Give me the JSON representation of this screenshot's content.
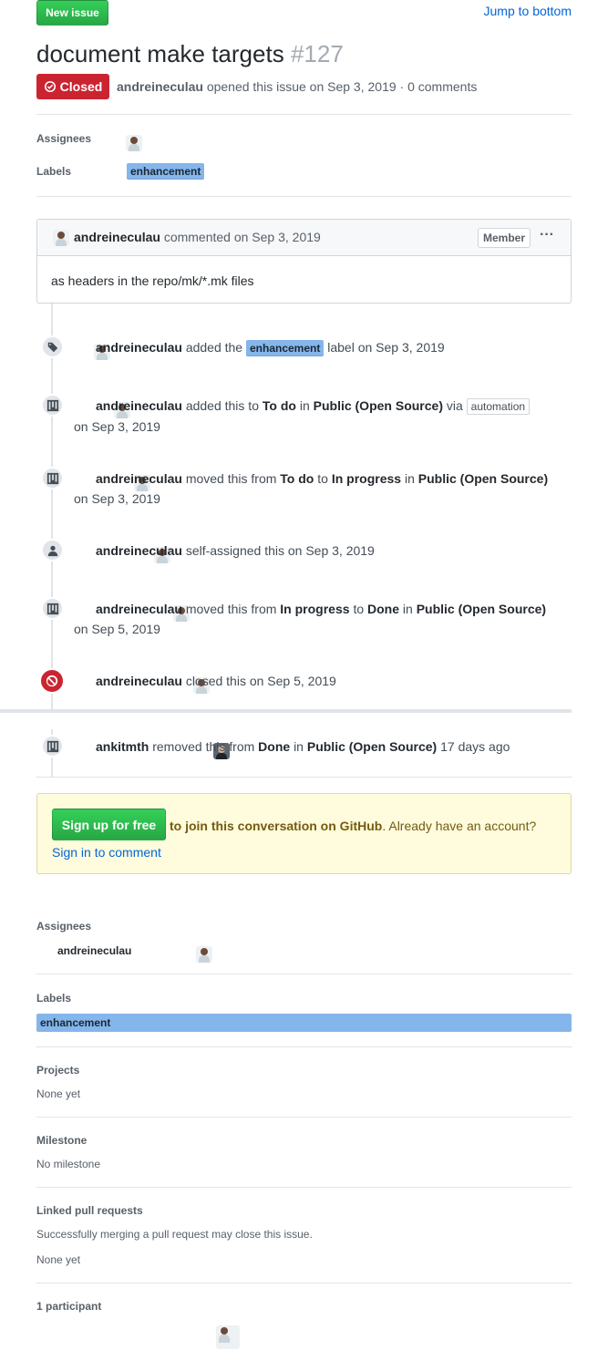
{
  "header": {
    "new_issue": "New issue",
    "jump": "Jump to bottom",
    "title": "document make targets",
    "number": "#127",
    "state": "Closed",
    "author": "andreineculau",
    "meta": "opened this issue on Sep 3, 2019 · 0 comments"
  },
  "top_meta": {
    "assignees_label": "Assignees",
    "labels_label": "Labels",
    "label": "enhancement"
  },
  "comment": {
    "author": "andreineculau",
    "meta": "commented on Sep 3, 2019",
    "role": "Member",
    "more": "···",
    "body": "as headers in the repo/mk/*.mk files"
  },
  "events": {
    "e1": {
      "user": "andreineculau",
      "t1": "added the",
      "label": "enhancement",
      "t2": "label on Sep 3, 2019"
    },
    "e2": {
      "user": "andreineculau",
      "t1": "added this to",
      "b1": "To do",
      "t2": "in",
      "b2": "Public (Open Source)",
      "t3": "via",
      "tag": "automation",
      "date": "on Sep 3, 2019"
    },
    "e3": {
      "user": "andreineculau",
      "t1": "moved this from",
      "b1": "To do",
      "t2": "to",
      "b2": "In progress",
      "t3": "in",
      "b3": "Public (Open Source)",
      "date": "on Sep 3, 2019"
    },
    "e4": {
      "user": "andreineculau",
      "t1": "self-assigned this on Sep 3, 2019"
    },
    "e5": {
      "user": "andreineculau",
      "t1": "moved this from",
      "b1": "In progress",
      "t2": "to",
      "b2": "Done",
      "t3": "in",
      "b3": "Public (Open Source)",
      "date": "on Sep 5, 2019"
    },
    "e6": {
      "user": "andreineculau",
      "t1": "closed this on Sep 5, 2019"
    },
    "e7": {
      "user": "ankitmth",
      "t1": "removed this from",
      "b1": "Done",
      "t2": "in",
      "b2": "Public (Open Source)",
      "t3": "17 days ago"
    }
  },
  "signup": {
    "button": "Sign up for free",
    "join": "to join this conversation on GitHub",
    "already": ". Already have an account?",
    "signin": "Sign in to comment"
  },
  "sidebar": {
    "assignees_h": "Assignees",
    "assignee": "andreineculau",
    "labels_h": "Labels",
    "label": "enhancement",
    "projects_h": "Projects",
    "projects_v": "None yet",
    "milestone_h": "Milestone",
    "milestone_v": "No milestone",
    "linked_h": "Linked pull requests",
    "linked_desc": "Successfully merging a pull request may close this issue.",
    "linked_v": "None yet",
    "participants_h": "1 participant"
  },
  "colors": {
    "closed": "#cb2431",
    "green": "#28a745",
    "label": "#84b6eb",
    "link": "#0366d6"
  }
}
